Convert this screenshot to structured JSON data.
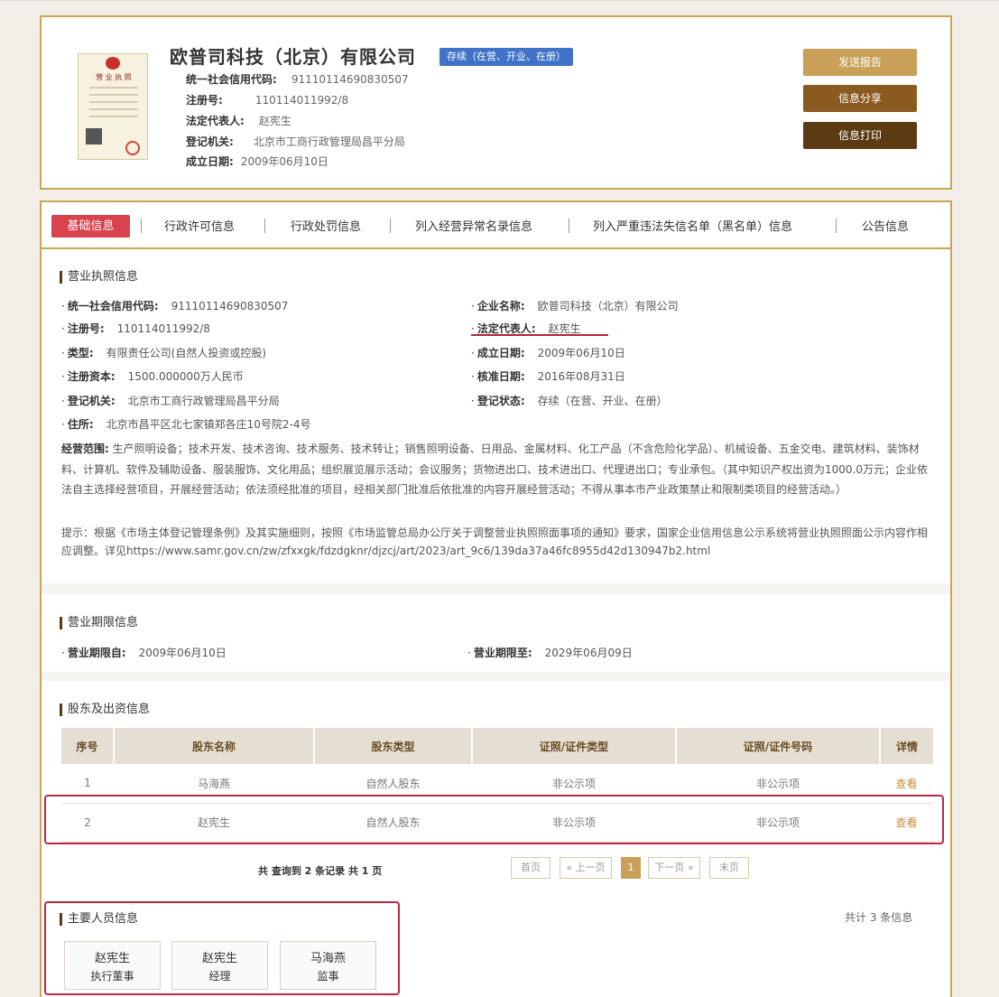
{
  "header": {
    "company_name": "欧普司科技（北京）有限公司",
    "status": "存续（在营、开业、在册）",
    "fields": [
      {
        "label": "统一社会信用代码:",
        "value": "91110114690830507"
      },
      {
        "label": "注册号:",
        "value": "110114011992/8"
      },
      {
        "label": "法定代表人:",
        "value": "赵宪生"
      },
      {
        "label": "登记机关:",
        "value": "北京市工商行政管理局昌平分局"
      },
      {
        "label": "成立日期:",
        "value": "2009年06月10日"
      }
    ],
    "buttons": [
      "发送报告",
      "信息分享",
      "信息打印"
    ],
    "license_title": "营 业 执 照"
  },
  "tabs": [
    "基础信息",
    "行政许可信息",
    "行政处罚信息",
    "列入经营异常名录信息",
    "列入严重违法失信名单（黑名单）信息",
    "公告信息"
  ],
  "license_section": {
    "title": "营业执照信息",
    "left": [
      {
        "label": "统一社会信用代码:",
        "value": "91110114690830507"
      },
      {
        "label": "注册号:",
        "value": "110114011992/8"
      },
      {
        "label": "类型:",
        "value": "有限责任公司(自然人投资或控股)"
      },
      {
        "label": "注册资本:",
        "value": "1500.000000万人民币"
      },
      {
        "label": "登记机关:",
        "value": "北京市工商行政管理局昌平分局"
      },
      {
        "label": "住所:",
        "value": "北京市昌平区北七家镇郑各庄10号院2-4号"
      }
    ],
    "right": [
      {
        "label": "企业名称:",
        "value": "欧普司科技（北京）有限公司"
      },
      {
        "label": "法定代表人:",
        "value": "赵宪生"
      },
      {
        "label": "成立日期:",
        "value": "2009年06月10日"
      },
      {
        "label": "核准日期:",
        "value": "2016年08月31日"
      },
      {
        "label": "登记状态:",
        "value": "存续（在营、开业、在册）"
      }
    ],
    "scope_label": "经营范围:",
    "scope_text": "生产照明设备；技术开发、技术咨询、技术服务、技术转让；销售照明设备、日用品、金属材料、化工产品（不含危险化学品）、机械设备、五金交电、建筑材料、装饰材料、计算机、软件及辅助设备、服装服饰、文化用品；组织展览展示活动；会议服务；货物进出口、技术进出口、代理进出口；专业承包。（其中知识产权出资为1000.0万元；企业依法自主选择经营项目，开展经营活动；依法须经批准的项目，经相关部门批准后依批准的内容开展经营活动；不得从事本市产业政策禁止和限制类项目的经营活动。）",
    "tip": "提示：根据《市场主体登记管理条例》及其实施细则，按照《市场监管总局办公厅关于调整营业执照照面事项的通知》要求，国家企业信用信息公示系统将营业执照照面公示内容作相应调整。详见https://www.samr.gov.cn/zw/zfxxgk/fdzdgknr/djzcj/art/2023/art_9c6/139da37a46fc8955d42d130947b2.html"
  },
  "term_section": {
    "title": "营业期限信息",
    "from_label": "营业期限自:",
    "from_value": "2009年06月10日",
    "to_label": "营业期限至:",
    "to_value": "2029年06月09日"
  },
  "shareholder_section": {
    "title": "股东及出资信息",
    "columns": [
      "序号",
      "股东名称",
      "股东类型",
      "证照/证件类型",
      "证照/证件号码",
      "详情"
    ],
    "rows": [
      [
        "1",
        "马海燕",
        "自然人股东",
        "非公示项",
        "非公示项",
        "查看"
      ],
      [
        "2",
        "赵宪生",
        "自然人股东",
        "非公示项",
        "非公示项",
        "查看"
      ]
    ],
    "pager_info": "共 查询到 2 条记录 共 1 页",
    "pager": [
      "首页",
      "« 上一页",
      "1",
      "下一页 »",
      "末页"
    ]
  },
  "staff_section": {
    "title": "主要人员信息",
    "total": "共计 3 条信息",
    "people": [
      {
        "name": "赵宪生",
        "role": "执行董事"
      },
      {
        "name": "赵宪生",
        "role": "经理"
      },
      {
        "name": "马海燕",
        "role": "监事"
      }
    ]
  },
  "colors": {
    "accent": "#c9a554",
    "active_tab": "#d9434e",
    "status_badge": "#3f72c8",
    "highlight": "#c2263f"
  }
}
